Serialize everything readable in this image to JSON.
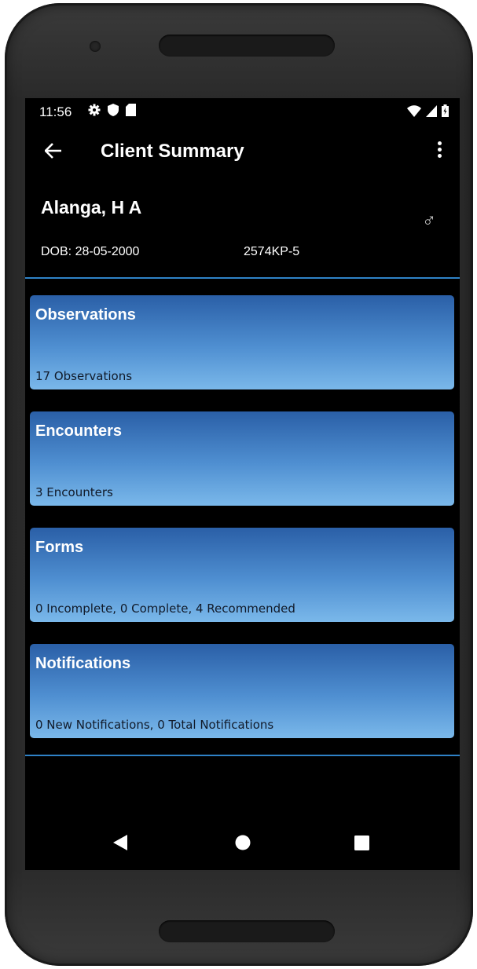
{
  "status_bar": {
    "time": "11:56"
  },
  "app_bar": {
    "title": "Client Summary"
  },
  "client": {
    "name": "Alanga, H A",
    "dob": "DOB: 28-05-2000",
    "id": "2574KP-5",
    "gender_symbol": "♂"
  },
  "cards": [
    {
      "title": "Observations",
      "summary": "17 Observations"
    },
    {
      "title": "Encounters",
      "summary": "3 Encounters"
    },
    {
      "title": "Forms",
      "summary": "0 Incomplete, 0 Complete, 4 Recommended"
    },
    {
      "title": "Notifications",
      "summary": "0 New Notifications, 0 Total Notifications"
    }
  ],
  "colors": {
    "accent": "#2f82c7",
    "card_top": "#2a5fa7",
    "card_bottom": "#7ab8ea"
  },
  "icons": {
    "status": [
      "gear-icon",
      "shield-icon",
      "sd-card-icon"
    ],
    "status_right": [
      "wifi-icon",
      "signal-icon",
      "battery-icon"
    ],
    "nav": [
      "back-triangle-icon",
      "home-circle-icon",
      "recents-square-icon"
    ]
  }
}
